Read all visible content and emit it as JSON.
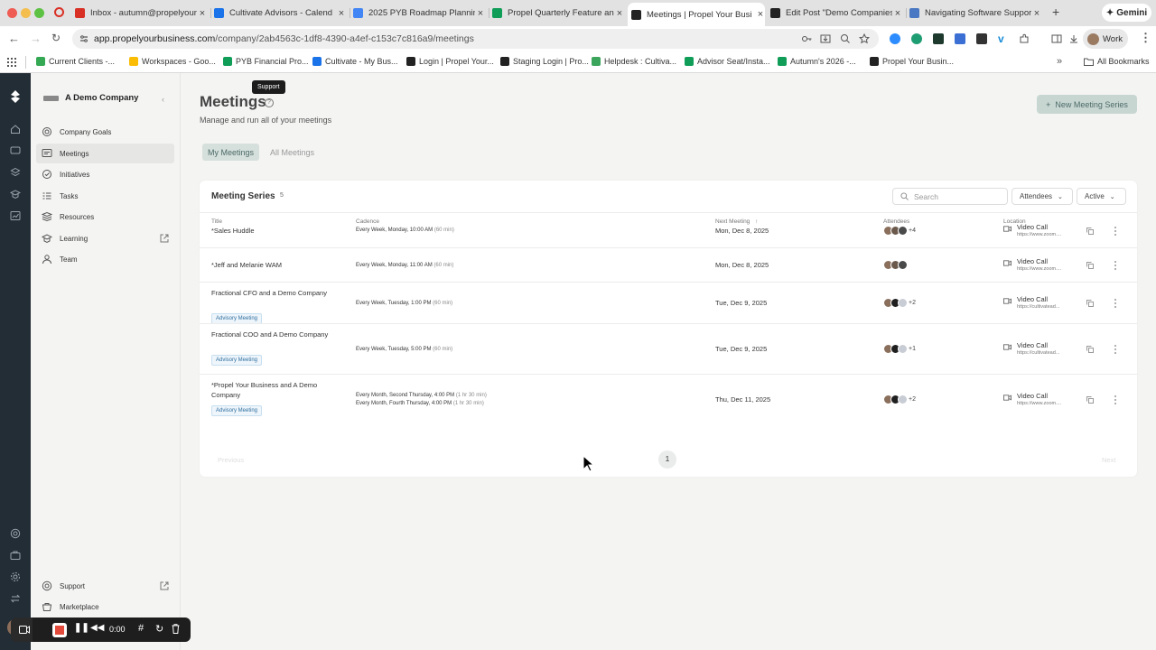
{
  "browser": {
    "tabs": [
      {
        "title": "Inbox - autumn@propelyour",
        "icon_color": "#d93025",
        "active": false
      },
      {
        "title": "Cultivate Advisors - Calend",
        "icon_color": "#1a73e8",
        "active": false
      },
      {
        "title": "2025 PYB Roadmap Planning",
        "icon_color": "#4285f4",
        "active": false
      },
      {
        "title": "Propel Quarterly Feature an",
        "icon_color": "#0f9d58",
        "active": false
      },
      {
        "title": "Meetings | Propel Your Busi",
        "icon_color": "#222222",
        "active": true
      },
      {
        "title": "Edit Post \"Demo Companies",
        "icon_color": "#222222",
        "active": false
      },
      {
        "title": "Navigating Software Suppor",
        "icon_color": "#4a78c2",
        "active": false
      }
    ],
    "new_tab_glyph": "+",
    "gemini_label": "Gemini",
    "address_host": "app.propelyourbusiness.com",
    "address_path": "/company/2ab4563c-1df8-4390-a4ef-c153c7c816a9/meetings",
    "profile_label": "Work",
    "bookmarks": [
      {
        "label": "Current Clients -...",
        "icon_color": "#34a853"
      },
      {
        "label": "Workspaces - Goo...",
        "icon_color": "#fbbc04"
      },
      {
        "label": "PYB Financial Pro...",
        "icon_color": "#0f9d58"
      },
      {
        "label": "Cultivate - My Bus...",
        "icon_color": "#1a73e8"
      },
      {
        "label": "Login | Propel Your...",
        "icon_color": "#222222"
      },
      {
        "label": "Staging Login | Pro...",
        "icon_color": "#222222"
      },
      {
        "label": "Helpdesk : Cultiva...",
        "icon_color": "#3ba55c"
      },
      {
        "label": "Advisor Seat/Insta...",
        "icon_color": "#0f9d58"
      },
      {
        "label": "Autumn's 2026 -...",
        "icon_color": "#0f9d58"
      },
      {
        "label": "Propel Your Busin...",
        "icon_color": "#222222"
      }
    ],
    "all_bookmarks_label": "All Bookmarks"
  },
  "sidebar": {
    "company_name": "A Demo Company",
    "items": [
      {
        "label": "Company Goals",
        "icon": "goal-icon"
      },
      {
        "label": "Meetings",
        "icon": "meetings-icon",
        "selected": true
      },
      {
        "label": "Initiatives",
        "icon": "initiatives-icon"
      },
      {
        "label": "Tasks",
        "icon": "tasks-icon"
      },
      {
        "label": "Resources",
        "icon": "resources-icon"
      },
      {
        "label": "Learning",
        "icon": "learning-icon",
        "external": true
      },
      {
        "label": "Team",
        "icon": "team-icon"
      }
    ],
    "bottom_items": [
      {
        "label": "Support",
        "icon": "support-icon",
        "external": true
      },
      {
        "label": "Marketplace",
        "icon": "marketplace-icon"
      }
    ]
  },
  "page": {
    "title": "Meetings",
    "tooltip": "Support",
    "subtitle": "Manage and run all of your meetings",
    "new_button": "New Meeting Series",
    "view_tabs": [
      "My Meetings",
      "All Meetings"
    ]
  },
  "table": {
    "title": "Meeting Series",
    "count": "5",
    "search_placeholder": "Search",
    "filters": [
      "Attendees",
      "Active"
    ],
    "columns": {
      "title": "Title",
      "cadence": "Cadence",
      "next": "Next Meeting",
      "attendees": "Attendees",
      "location": "Location"
    },
    "rows": [
      {
        "title": "*Sales Huddle",
        "tag": "",
        "cadence": [
          {
            "text": "Every Week, Monday, 10:00 AM",
            "dur": "(60 min)"
          }
        ],
        "next": "Mon, Dec 8, 2025",
        "extra": "+4",
        "loc_type": "Video Call",
        "loc_url": "https://www.zoom...."
      },
      {
        "title": "*Jeff and Melanie WAM",
        "tag": "",
        "cadence": [
          {
            "text": "Every Week, Monday, 11:00 AM",
            "dur": "(60 min)"
          }
        ],
        "next": "Mon, Dec 8, 2025",
        "extra": "",
        "loc_type": "Video Call",
        "loc_url": "https://www.zoom...."
      },
      {
        "title": "Fractional CFO and a Demo Company",
        "tag": "Advisory Meeting",
        "cadence": [
          {
            "text": "Every Week, Tuesday, 1:00 PM",
            "dur": "(60 min)"
          }
        ],
        "next": "Tue, Dec 9, 2025",
        "extra": "+2",
        "loc_type": "Video Call",
        "loc_url": "https://cultivatead..."
      },
      {
        "title": "Fractional COO and A Demo Company",
        "tag": "Advisory Meeting",
        "cadence": [
          {
            "text": "Every Week, Tuesday, 5:00 PM",
            "dur": "(60 min)"
          }
        ],
        "next": "Tue, Dec 9, 2025",
        "extra": "+1",
        "loc_type": "Video Call",
        "loc_url": "https://cultivatead..."
      },
      {
        "title": "*Propel Your Business and A Demo Company",
        "tag": "Advisory Meeting",
        "cadence": [
          {
            "text": "Every Month, Second Thursday, 4:00 PM",
            "dur": "(1 hr 30 min)"
          },
          {
            "text": "Every Month, Fourth Thursday, 4:00 PM",
            "dur": "(1 hr 30 min)"
          }
        ],
        "next": "Thu, Dec 11, 2025",
        "extra": "+2",
        "loc_type": "Video Call",
        "loc_url": "https://www.zoom...."
      }
    ],
    "pagination": {
      "prev": "Previous",
      "page": "1",
      "next": "Next"
    }
  },
  "recorder": {
    "time": "0:00"
  },
  "colors": {
    "rail": "#232d36",
    "accent": "#4c6b66",
    "tag": "#2f6f9f"
  }
}
